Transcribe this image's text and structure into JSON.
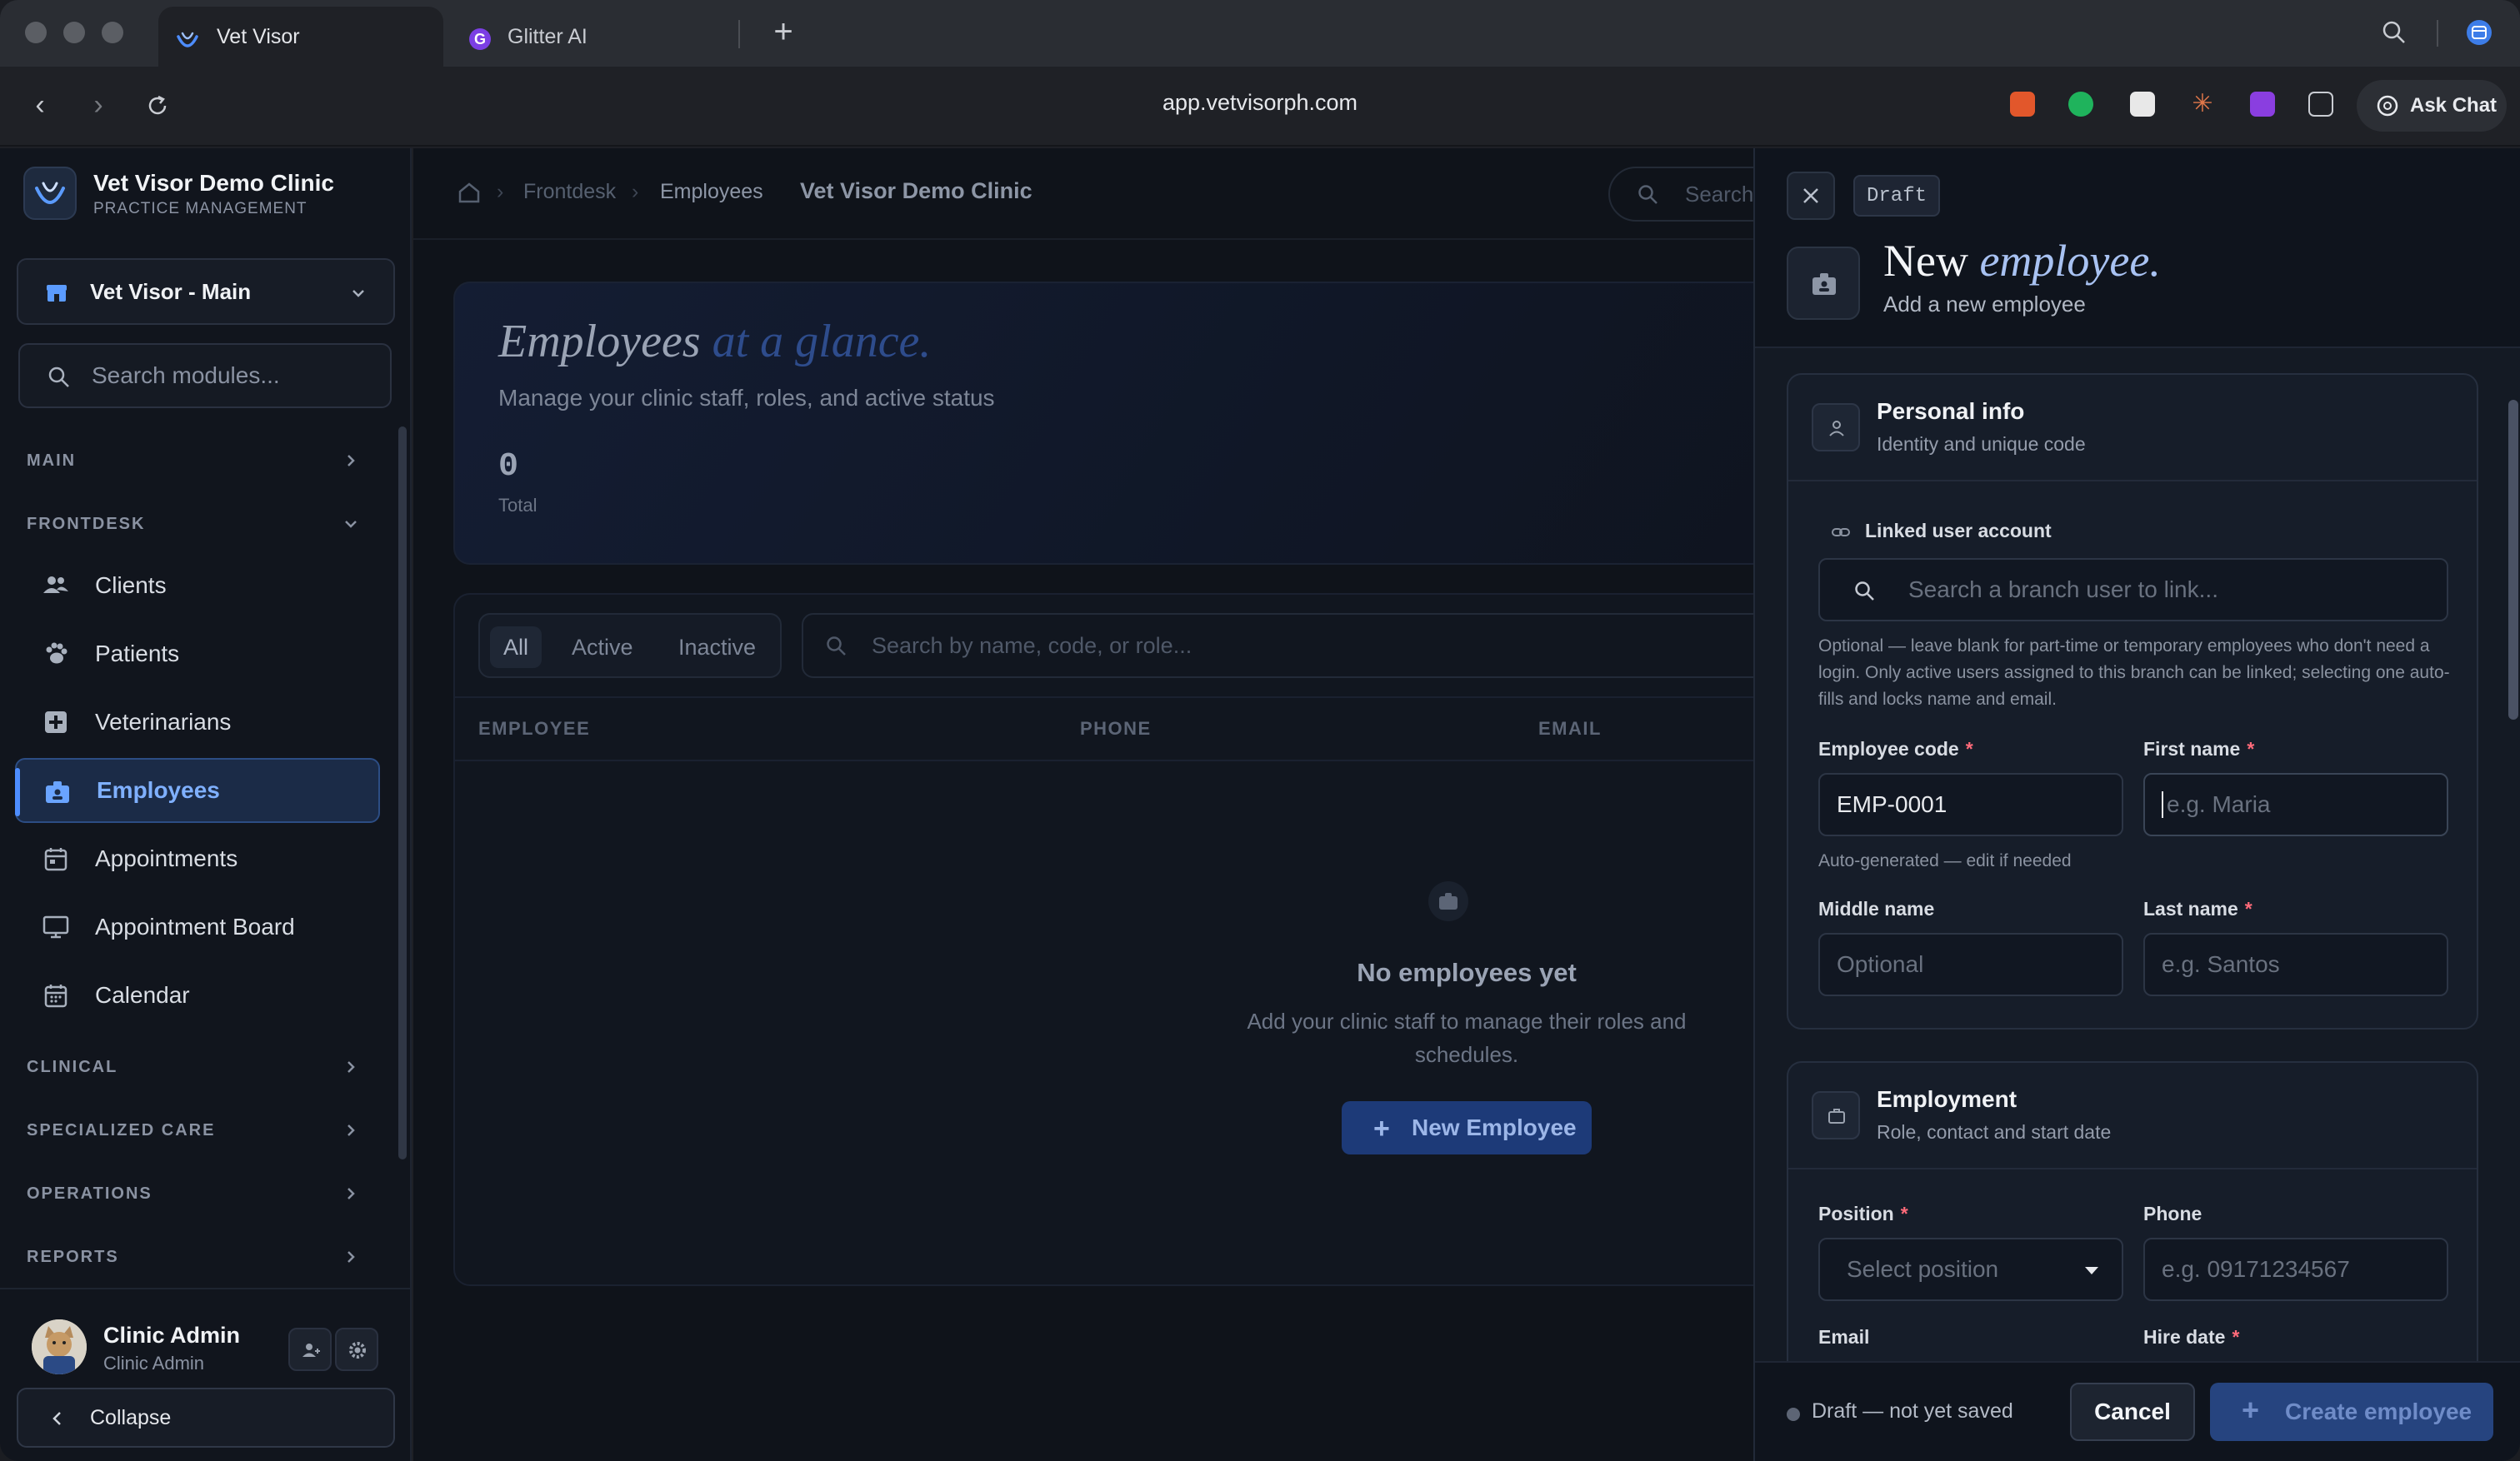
{
  "browser": {
    "tabs": [
      {
        "label": "Vet Visor",
        "active": true
      },
      {
        "label": "Glitter AI",
        "active": false
      }
    ],
    "url": "app.vetvisorph.com",
    "ask_chat": "Ask Chat"
  },
  "sidebar": {
    "brand_name": "Vet Visor Demo Clinic",
    "brand_sub": "PRACTICE MANAGEMENT",
    "branch": "Vet Visor - Main",
    "search_placeholder": "Search modules...",
    "sections": {
      "main": "MAIN",
      "frontdesk": "FRONTDESK",
      "clinical": "CLINICAL",
      "specialized": "SPECIALIZED CARE",
      "operations": "OPERATIONS",
      "reports": "REPORTS"
    },
    "items": [
      {
        "label": "Clients",
        "icon": "users-icon"
      },
      {
        "label": "Patients",
        "icon": "paw-icon"
      },
      {
        "label": "Veterinarians",
        "icon": "medical-plus-icon"
      },
      {
        "label": "Employees",
        "icon": "badge-icon",
        "active": true
      },
      {
        "label": "Appointments",
        "icon": "calendar-icon"
      },
      {
        "label": "Appointment Board",
        "icon": "monitor-icon"
      },
      {
        "label": "Calendar",
        "icon": "calendar-grid-icon"
      }
    ],
    "user": {
      "name": "Clinic Admin",
      "role": "Clinic Admin"
    },
    "collapse": "Collapse"
  },
  "main": {
    "breadcrumb": [
      "Frontdesk",
      "Employees"
    ],
    "clinic": "Vet Visor Demo Clinic",
    "top_search_placeholder": "Search",
    "hero": {
      "title_main": "Employees",
      "title_accent": "at a glance.",
      "subtitle": "Manage your clinic staff, roles, and active status",
      "total_value": "0",
      "total_label": "Total"
    },
    "filters": [
      "All",
      "Active",
      "Inactive"
    ],
    "table_search_placeholder": "Search by name, code, or role...",
    "columns": [
      "EMPLOYEE",
      "PHONE",
      "EMAIL"
    ],
    "empty": {
      "title": "No employees yet",
      "subtitle": "Add your clinic staff to manage their roles and schedules.",
      "button": "New Employee"
    }
  },
  "drawer": {
    "badge": "Draft",
    "title_main": "New",
    "title_em": "employee.",
    "subtitle": "Add a new employee",
    "personal": {
      "title": "Personal info",
      "subtitle": "Identity and unique code",
      "linked_label": "Linked user account",
      "linked_placeholder": "Search a branch user to link...",
      "linked_hint": "Optional — leave blank for part-time or temporary employees who don't need a login. Only active users assigned to this branch can be linked; selecting one auto-fills and locks name and email.",
      "code_label": "Employee code",
      "code_value": "EMP-0001",
      "code_hint": "Auto-generated — edit if needed",
      "first_label": "First name",
      "first_placeholder": "e.g. Maria",
      "middle_label": "Middle name",
      "middle_placeholder": "Optional",
      "last_label": "Last name",
      "last_placeholder": "e.g. Santos"
    },
    "employment": {
      "title": "Employment",
      "subtitle": "Role, contact and start date",
      "position_label": "Position",
      "position_placeholder": "Select position",
      "phone_label": "Phone",
      "phone_placeholder": "e.g. 09171234567",
      "email_label": "Email",
      "hire_label": "Hire date"
    },
    "footer": {
      "status": "Draft — not yet saved",
      "cancel": "Cancel",
      "create": "Create employee"
    }
  },
  "colors": {
    "accent": "#4d8dff",
    "required": "#ff6b7a"
  }
}
